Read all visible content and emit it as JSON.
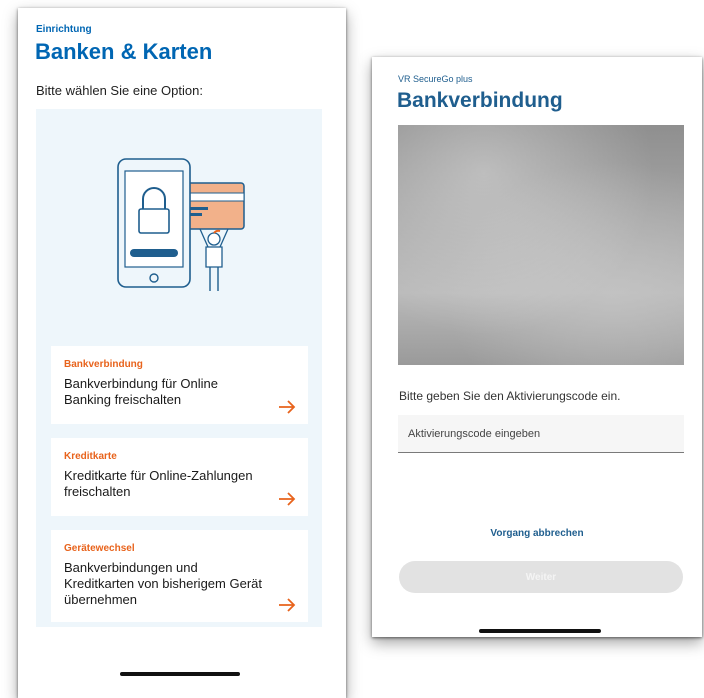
{
  "left": {
    "overline": "Einrichtung",
    "title": "Banken & Karten",
    "subtitle": "Bitte wählen Sie eine Option:",
    "options": [
      {
        "label": "Bankverbindung",
        "text": "Bankverbindung für Online\nBanking freischalten"
      },
      {
        "label": "Kreditkarte",
        "text": "Kreditkarte für Online-Zahlungen\nfreischalten"
      },
      {
        "label": "Gerätewechsel",
        "text": "Bankverbindungen und\nKreditkarten von bisherigem Gerät\nübernehmen"
      }
    ]
  },
  "right": {
    "overline": "VR SecureGo plus",
    "title": "Bankverbindung",
    "instruction": "Bitte geben Sie den Aktivierungscode ein.",
    "code_placeholder": "Aktivierungscode eingeben",
    "cancel_label": "Vorgang abbrechen",
    "next_label": "Weiter"
  },
  "colors": {
    "primary_blue": "#0066b3",
    "accent_orange": "#e8631c",
    "panel_bg": "#eef6fb"
  },
  "icons": [
    "phone-lock-card-illustration",
    "arrow-right-icon"
  ]
}
